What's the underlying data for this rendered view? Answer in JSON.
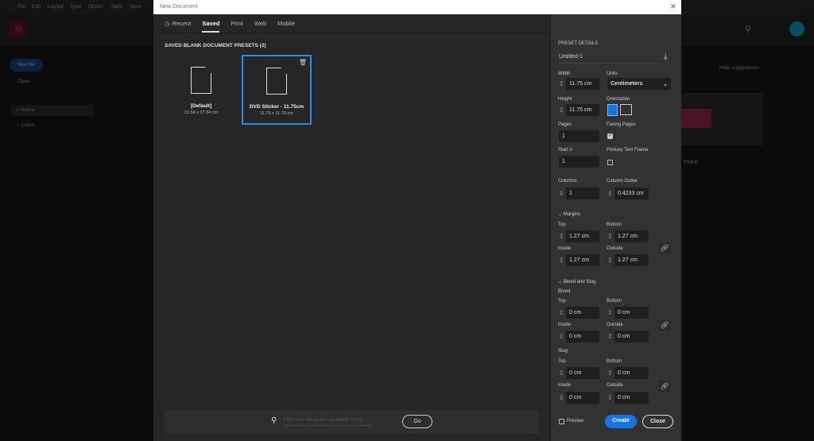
{
  "background_app": {
    "menu": [
      "File",
      "Edit",
      "Layout",
      "Type",
      "Object",
      "Table",
      "View"
    ],
    "logo": "Id",
    "new_file": "New file",
    "open": "Open",
    "nav": [
      "Home",
      "Learn"
    ],
    "hide_suggestions": "Hide suggestions",
    "find_more": "d more"
  },
  "dialog": {
    "title": "New Document",
    "tabs": [
      "Recent",
      "Saved",
      "Print",
      "Web",
      "Mobile"
    ],
    "section_title": "SAVED BLANK DOCUMENT PRESETS  (2)",
    "presets": [
      {
        "name": "[Default]",
        "size": "21.59 x 27.94 cm"
      },
      {
        "name": "DVD Sticker - 11.75cm",
        "size": "11.75 x 11.75 cm"
      }
    ],
    "search_placeholder": "Find more templates on Adobe Stock",
    "go": "Go",
    "details": {
      "heading": "PRESET DETAILS",
      "name": "Untitled-1",
      "width_label": "Width",
      "width": "11.75 cm",
      "units_label": "Units",
      "units": "Centimeters",
      "height_label": "Height",
      "height": "11.75 cm",
      "orientation_label": "Orientation",
      "pages_label": "Pages",
      "pages": "1",
      "facing_label": "Facing Pages",
      "facing_checked": true,
      "start_label": "Start #",
      "start": "1",
      "ptf_label": "Primary Text Frame",
      "ptf_checked": false,
      "columns_label": "Columns",
      "columns": "1",
      "gutter_label": "Column Gutter",
      "gutter": "0.4233 cm",
      "margins_label": "Margins",
      "top_label": "Top",
      "bottom_label": "Bottom",
      "inside_label": "Inside",
      "outside_label": "Outside",
      "margin_top": "1.27 cm",
      "margin_bottom": "1.27 cm",
      "margin_inside": "1.27 cm",
      "margin_outside": "1.27 cm",
      "bleed_slug_label": "Bleed and Slug",
      "bleed_label": "Bleed",
      "slug_label": "Slug",
      "bleed_top": "0 cm",
      "bleed_bottom": "0 cm",
      "bleed_inside": "0 cm",
      "bleed_outside": "0 cm",
      "slug_top": "0 cm",
      "slug_bottom": "0 cm",
      "slug_inside": "0 cm",
      "slug_outside": "0 cm"
    },
    "preview": "Preview",
    "create": "Create",
    "close": "Close"
  },
  "colors": {
    "accent": "#1473e6"
  }
}
